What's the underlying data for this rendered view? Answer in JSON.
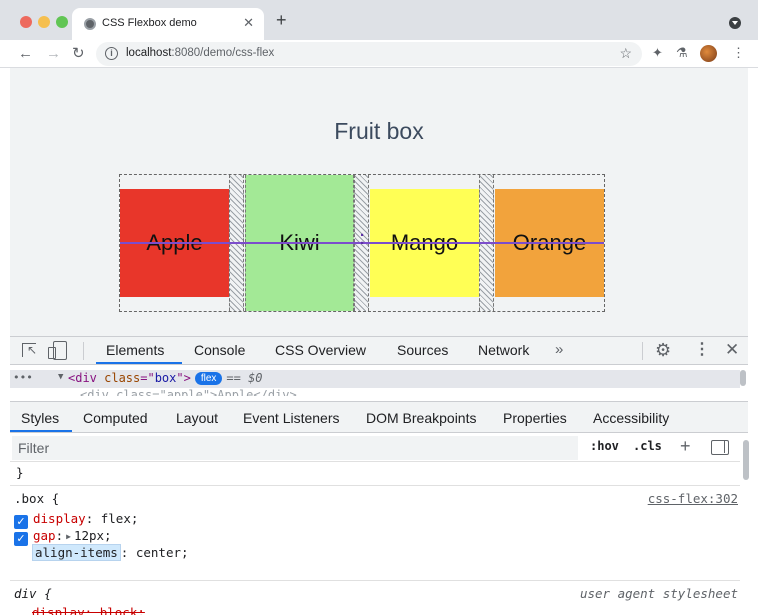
{
  "browser": {
    "tab_title": "CSS Flexbox demo",
    "tab_close": "✕",
    "new_tab": "+",
    "url_host": "localhost",
    "url_path": ":8080/demo/css-flex",
    "icons": [
      "back-icon",
      "forward-icon",
      "reload-icon",
      "info-icon",
      "star-icon",
      "extensions-icon",
      "flask-icon",
      "avatar",
      "menu-icon"
    ]
  },
  "page": {
    "title": "Fruit box",
    "items": [
      {
        "label": "Apple",
        "color": "#e8362a"
      },
      {
        "label": "Kiwi",
        "color": "#a3e996"
      },
      {
        "label": "Mango",
        "color": "#ffff55"
      },
      {
        "label": "Orange",
        "color": "#f2a33c"
      }
    ],
    "overlay_color": "#7c4dcc"
  },
  "devtools": {
    "tabs": [
      "Elements",
      "Console",
      "CSS Overview",
      "Sources",
      "Network"
    ],
    "active_tab": "Elements",
    "more": "»",
    "dom": {
      "ellipsis": "•••",
      "tag_open": "<div ",
      "attr_name": "class",
      "attr_eq": "=\"",
      "attr_value": "box",
      "attr_close": "\">",
      "badge": "flex",
      "selected_marker": "== $0",
      "next_line": "<div class=\"apple\">Apple</div>"
    },
    "styles_tabs": [
      "Styles",
      "Computed",
      "Layout",
      "Event Listeners",
      "DOM Breakpoints",
      "Properties",
      "Accessibility"
    ],
    "active_styles_tab": "Styles",
    "filter_placeholder": "Filter",
    "hov": ":hov",
    "cls": ".cls",
    "plus": "+",
    "rules": {
      "prev_close": "}",
      "box_selector": ".box {",
      "box_source": "css-flex:302",
      "props": [
        {
          "name": "display",
          "value": "flex;",
          "checked": true
        },
        {
          "name": "gap",
          "value": "12px;",
          "checked": true,
          "expandable": true
        },
        {
          "name": "align-items",
          "value": "center;",
          "checked": false,
          "editing": true
        }
      ],
      "ua_selector": "div {",
      "ua_source": "user agent stylesheet",
      "ua_prop": "display: block;"
    },
    "accent": "#1a73e8"
  }
}
